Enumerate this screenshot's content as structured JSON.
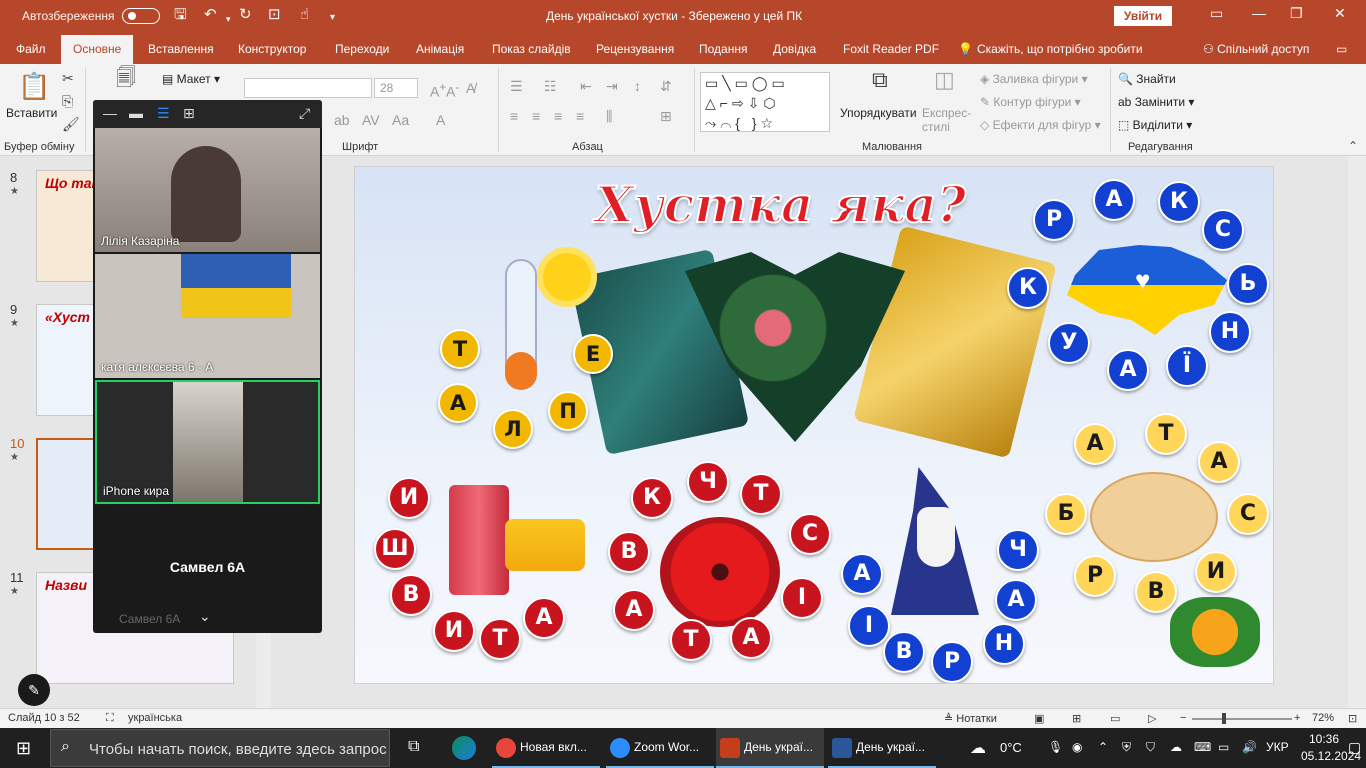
{
  "titlebar": {
    "autosave_label": "Автозбереження",
    "autosave_state": "off",
    "document_title": "День української хустки  -  Збережено у цей ПК",
    "signin_label": "Увійти"
  },
  "tabs": {
    "items": [
      "Файл",
      "Основне",
      "Вставлення",
      "Конструктор",
      "Переходи",
      "Анімація",
      "Показ слайдів",
      "Рецензування",
      "Подання",
      "Довідка",
      "Foxit Reader PDF"
    ],
    "active": "Основне",
    "tell_me": "Скажіть, що потрібно зробити",
    "share": "Спільний доступ"
  },
  "ribbon": {
    "clipboard": {
      "label": "Буфер обміну",
      "paste": "Вставити"
    },
    "slides": {
      "layout": "Макет"
    },
    "font": {
      "label": "Шрифт",
      "font_name": "",
      "font_size": "28"
    },
    "paragraph": {
      "label": "Абзац"
    },
    "drawing": {
      "label": "Малювання",
      "arrange": "Упорядкувати",
      "quick_styles": "Експрес-стилі",
      "shape_fill": "Заливка фігури",
      "shape_outline": "Контур фігури",
      "shape_effects": "Ефекти для фігур"
    },
    "editing": {
      "label": "Редагування",
      "find": "Знайти",
      "replace": "Замінити",
      "select": "Виділити"
    }
  },
  "thumbnails": {
    "items": [
      {
        "num": "8",
        "title": "Що так хустка",
        "selected": false
      },
      {
        "num": "9",
        "title": "«Хуст",
        "selected": false
      },
      {
        "num": "10",
        "title": "",
        "selected": true
      },
      {
        "num": "11",
        "title": "Назви",
        "selected": false
      }
    ]
  },
  "zoom": {
    "participants": [
      "Лілія Казаріна",
      "катя алєксєєва 6 - А",
      "iPhone кира"
    ],
    "active_speaker": "Самвел 6А",
    "muted_label": "Самвел 6А"
  },
  "slide": {
    "title": "Хустка яка?",
    "groups": {
      "blue_top": [
        "А",
        "К",
        "Р",
        "С",
        "К",
        "Ь",
        "У",
        "Н",
        "А",
        "Ї"
      ],
      "orange_left": [
        "Т",
        "Е",
        "А",
        "П",
        "Л"
      ],
      "cream_right": [
        "А",
        "Т",
        "А",
        "С",
        "Б",
        "И",
        "Р",
        "В"
      ],
      "red_left": [
        "И",
        "Ш",
        "В",
        "И",
        "Т",
        "А"
      ],
      "red_center": [
        "Ч",
        "К",
        "Т",
        "В",
        "С",
        "А",
        "І",
        "Т",
        "А"
      ],
      "blue_bottom": [
        "Ч",
        "А",
        "А",
        "І",
        "Н",
        "В",
        "Р"
      ]
    }
  },
  "statusbar": {
    "slide_info": "Слайд 10 з 52",
    "language": "українська",
    "notes": "Нотатки",
    "zoom_percent": "72%"
  },
  "taskbar": {
    "search_placeholder": "Чтобы начать поиск, введите здесь запрос",
    "apps": [
      {
        "label": "Новая вкл...",
        "color": "#e8453c"
      },
      {
        "label": "Zoom Wor...",
        "color": "#2d8cff"
      },
      {
        "label": "День украї...",
        "color": "#c43e1c"
      },
      {
        "label": "День украї...",
        "color": "#2b579a"
      }
    ],
    "weather": "0°C",
    "language": "УКР",
    "time": "10:36",
    "date": "05.12.2024"
  }
}
